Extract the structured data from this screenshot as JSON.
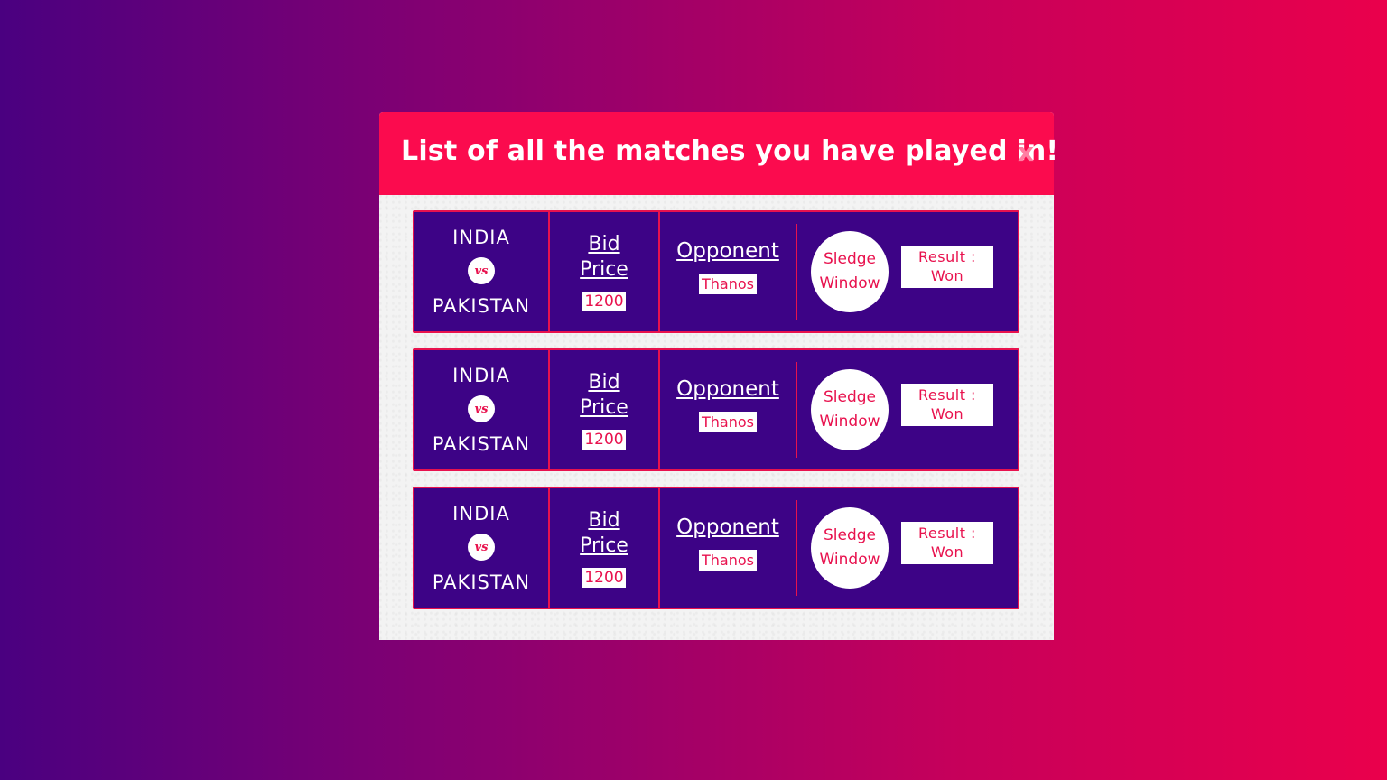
{
  "modal": {
    "title": "List of all the matches you have played in!",
    "close_label": "x"
  },
  "colors": {
    "header": "#fb0b4e",
    "card_bg": "#3d0386",
    "accent": "#e8124e",
    "bg_gradient_start": "#4a0080",
    "bg_gradient_end": "#ea004c"
  },
  "matches": [
    {
      "team_a": "INDIA",
      "vs": "vs",
      "team_b": "PAKISTAN",
      "bid_label": "Bid Price",
      "bid_value": "1200",
      "opponent_label": "Opponent",
      "opponent_value": "Thanos",
      "sledge_label": "Sledge Window",
      "result_label": "Result :",
      "result_value": "Won"
    },
    {
      "team_a": "INDIA",
      "vs": "vs",
      "team_b": "PAKISTAN",
      "bid_label": "Bid Price",
      "bid_value": "1200",
      "opponent_label": "Opponent",
      "opponent_value": "Thanos",
      "sledge_label": "Sledge Window",
      "result_label": "Result :",
      "result_value": "Won"
    },
    {
      "team_a": "INDIA",
      "vs": "vs",
      "team_b": "PAKISTAN",
      "bid_label": "Bid Price",
      "bid_value": "1200",
      "opponent_label": "Opponent",
      "opponent_value": "Thanos",
      "sledge_label": "Sledge Window",
      "result_label": "Result :",
      "result_value": "Won"
    }
  ]
}
